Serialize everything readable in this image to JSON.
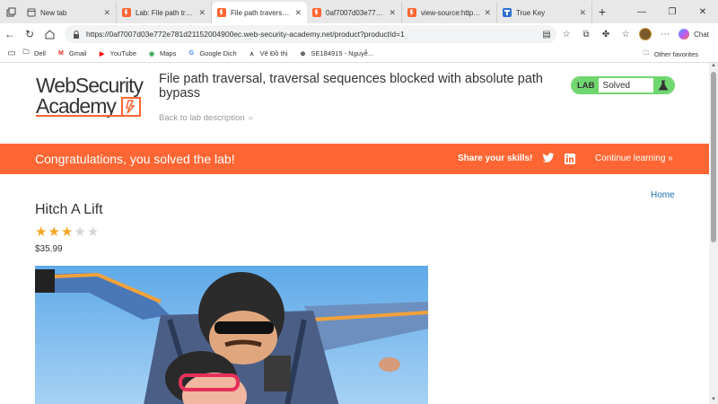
{
  "browser": {
    "tabs": [
      {
        "title": "New tab",
        "icon": "page-icon",
        "active": false
      },
      {
        "title": "Lab: File path traversal",
        "icon": "portswigger-icon",
        "active": false
      },
      {
        "title": "File path traversal, tra",
        "icon": "portswigger-icon",
        "active": true
      },
      {
        "title": "0af7007d03e772e781",
        "icon": "portswigger-icon",
        "active": false
      },
      {
        "title": "view-source:https://0a",
        "icon": "portswigger-icon",
        "active": false
      },
      {
        "title": "True Key",
        "icon": "truekey-icon",
        "active": false
      }
    ],
    "new_tab": "+",
    "url": "https://0af7007d03e772e781d21152004900ec.web-security-academy.net/product?productId=1",
    "chat_label": "Chat",
    "bookmarks": [
      {
        "label": "Dell",
        "icon": "folder-icon"
      },
      {
        "label": "Gmail",
        "icon": "gmail-icon"
      },
      {
        "label": "YouTube",
        "icon": "youtube-icon"
      },
      {
        "label": "Maps",
        "icon": "maps-icon"
      },
      {
        "label": "Google Dịch",
        "icon": "translate-icon"
      },
      {
        "label": "Vẽ Đồ thị",
        "icon": "graph-icon"
      },
      {
        "label": "SE184915 - Nguyễ...",
        "icon": "globe-icon"
      }
    ],
    "other_favorites": "Other favorites"
  },
  "lab": {
    "logo_line1": "WebSecurity",
    "logo_line2": "Academy",
    "title": "File path traversal, traversal sequences blocked with absolute path bypass",
    "back_link": "Back to lab description",
    "status_tag": "LAB",
    "status_value": "Solved",
    "accent": "#ff6633",
    "solved_color": "#70d670"
  },
  "banner": {
    "message": "Congratulations, you solved the lab!",
    "share": "Share your skills!",
    "continue": "Continue learning"
  },
  "product": {
    "home_link": "Home",
    "name": "Hitch A Lift",
    "rating": 3,
    "rating_max": 5,
    "price": "$35.99"
  }
}
